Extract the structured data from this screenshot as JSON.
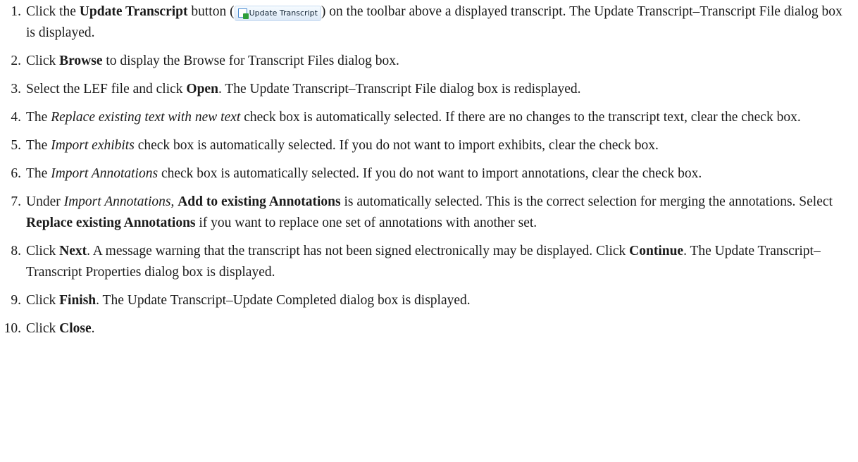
{
  "steps": [
    {
      "num": "1.",
      "segments": [
        {
          "t": "Click the "
        },
        {
          "t": "Update Transcript",
          "s": "b"
        },
        {
          "t": " button ("
        },
        {
          "t": "Update Transcript",
          "s": "icon",
          "icon": "update-transcript-icon"
        },
        {
          "t": ") on the toolbar above a displayed transcript. The Update Transcript–Transcript File dialog box is displayed."
        }
      ]
    },
    {
      "num": "2.",
      "segments": [
        {
          "t": "Click "
        },
        {
          "t": "Browse",
          "s": "b"
        },
        {
          "t": " to display the Browse for Transcript Files dialog box."
        }
      ]
    },
    {
      "num": "3.",
      "segments": [
        {
          "t": "Select the LEF file and click "
        },
        {
          "t": "Open",
          "s": "b"
        },
        {
          "t": ". The Update Transcript–Transcript File dialog box is redisplayed."
        }
      ]
    },
    {
      "num": "4.",
      "segments": [
        {
          "t": "The "
        },
        {
          "t": "Replace existing text with new text",
          "s": "i"
        },
        {
          "t": " check box is automatically selected. If there are no changes to the transcript text, clear the check box."
        }
      ]
    },
    {
      "num": "5.",
      "segments": [
        {
          "t": "The "
        },
        {
          "t": "Import exhibits",
          "s": "i"
        },
        {
          "t": " check box is automatically selected. If you do not want to import exhibits, clear the check box."
        }
      ]
    },
    {
      "num": "6.",
      "segments": [
        {
          "t": "The "
        },
        {
          "t": "Import Annotations",
          "s": "i"
        },
        {
          "t": " check box is automatically selected. If you do not want to import annotations, clear the check box."
        }
      ]
    },
    {
      "num": "7.",
      "segments": [
        {
          "t": "Under "
        },
        {
          "t": "Import Annotations",
          "s": "i"
        },
        {
          "t": ", "
        },
        {
          "t": "Add to existing Annotations",
          "s": "b"
        },
        {
          "t": " is automatically selected. This is the correct selection for merging the annotations. Select "
        },
        {
          "t": "Replace existing Annotations",
          "s": "b"
        },
        {
          "t": " if you want to replace one set of annotations with another set."
        }
      ]
    },
    {
      "num": "8.",
      "segments": [
        {
          "t": "Click "
        },
        {
          "t": "Next",
          "s": "b"
        },
        {
          "t": ". A message warning that the transcript has not been signed electronically may be displayed. Click "
        },
        {
          "t": "Continue",
          "s": "b"
        },
        {
          "t": ". The Update Transcript–Transcript Properties dialog box is displayed."
        }
      ]
    },
    {
      "num": "9.",
      "segments": [
        {
          "t": "Click "
        },
        {
          "t": "Finish",
          "s": "b"
        },
        {
          "t": ". The Update Transcript–Update Completed dialog box is displayed."
        }
      ]
    },
    {
      "num": "10.",
      "segments": [
        {
          "t": "Click "
        },
        {
          "t": "Close",
          "s": "b"
        },
        {
          "t": "."
        }
      ]
    }
  ],
  "colors": {
    "text": "#1a1a1a",
    "icon_accent": "#2e9e3a",
    "icon_border": "#4a8ad0"
  }
}
